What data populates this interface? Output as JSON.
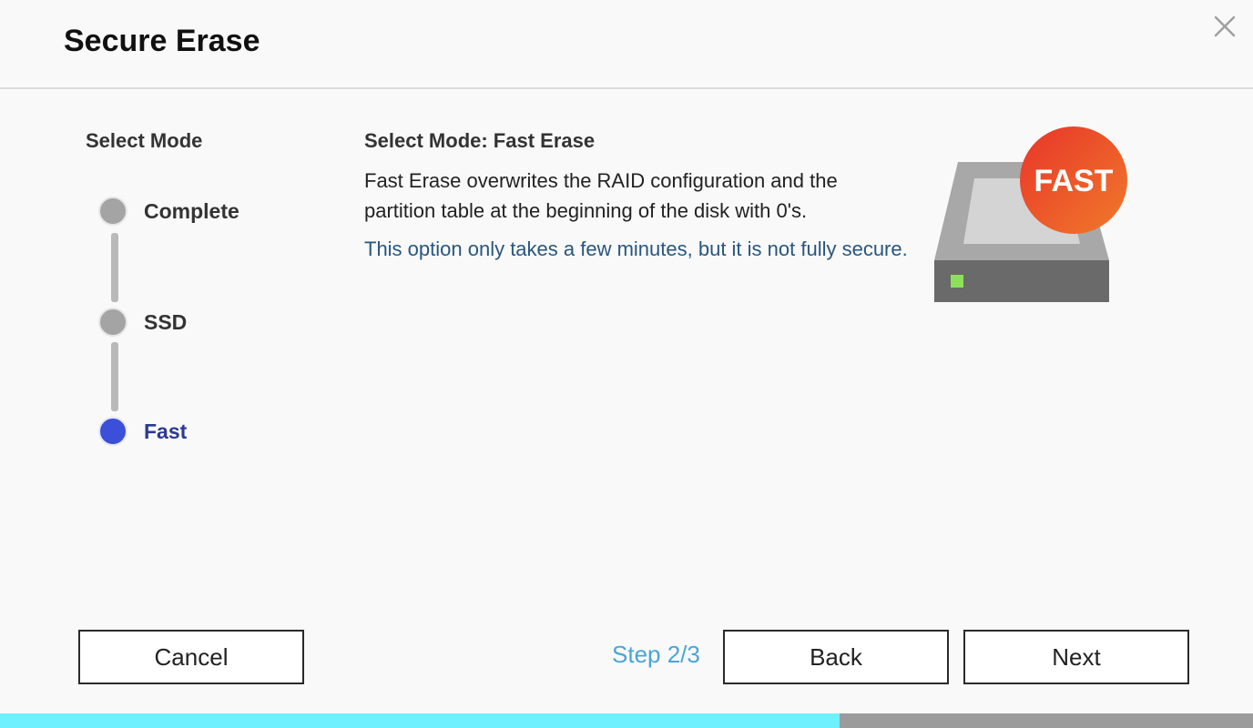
{
  "dialog": {
    "title": "Secure Erase"
  },
  "steps": {
    "heading": "Select Mode",
    "items": [
      {
        "label": "Complete",
        "state": "inactive"
      },
      {
        "label": "SSD",
        "state": "inactive"
      },
      {
        "label": "Fast",
        "state": "active"
      }
    ]
  },
  "mode": {
    "title": "Select Mode: Fast Erase",
    "description": "Fast Erase overwrites the RAID configuration and the partition table at the beginning of the disk with 0's.",
    "note": "This option only takes a few minutes, but it is not fully secure.",
    "badge": "FAST"
  },
  "footer": {
    "cancel_label": "Cancel",
    "back_label": "Back",
    "next_label": "Next",
    "step_indicator": "Step 2/3"
  },
  "progress": {
    "fraction": 0.67
  },
  "colors": {
    "active_step": "#3b4fd8",
    "inactive_step": "#a4a4a4",
    "note_text": "#28567e",
    "step_indicator": "#4aa5d6",
    "progress_fill": "#6ff0ff",
    "progress_track": "#9b9b9b",
    "badge_gradient_start": "#e8352a",
    "badge_gradient_end": "#f07a2a"
  },
  "icons": {
    "close": "close-icon",
    "illustration": "drive-fast-icon"
  }
}
